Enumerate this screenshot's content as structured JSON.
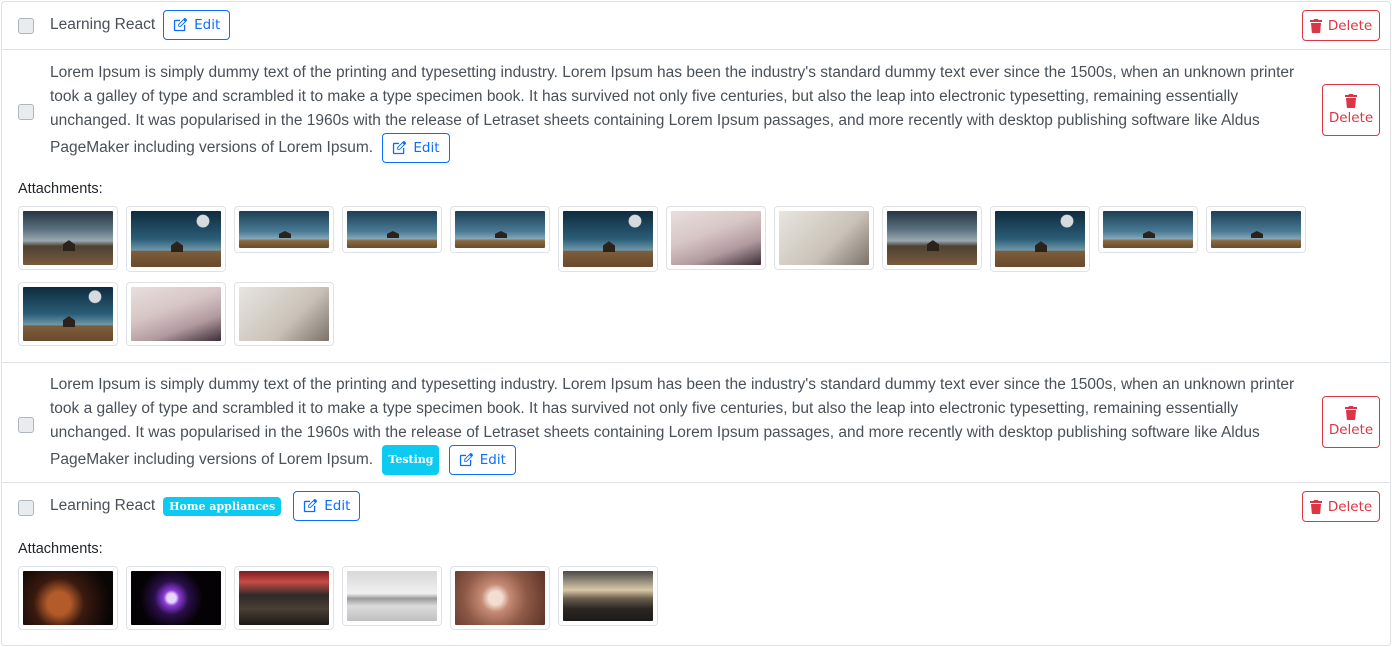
{
  "items": [
    {
      "title": "Learning React",
      "edit_label": "Edit",
      "delete_label": "Delete"
    },
    {
      "description": "Lorem Ipsum is simply dummy text of the printing and typesetting industry. Lorem Ipsum has been the industry's standard dummy text ever since the 1500s, when an unknown printer took a galley of type and scrambled it to make a type specimen book. It has survived not only five centuries, but also the leap into electronic typesetting, remaining essentially unchanged. It was popularised in the 1960s with the release of Letraset sheets containing Lorem Ipsum passages, and more recently with desktop publishing software like Aldus PageMaker including versions of Lorem Ipsum.",
      "edit_label": "Edit",
      "delete_label": "Delete",
      "attachments_label": "Attachments:"
    },
    {
      "description": "Lorem Ipsum is simply dummy text of the printing and typesetting industry. Lorem Ipsum has been the industry's standard dummy text ever since the 1500s, when an unknown printer took a galley of type and scrambled it to make a type specimen book. It has survived not only five centuries, but also the leap into electronic typesetting, remaining essentially unchanged. It was popularised in the 1960s with the release of Letraset sheets containing Lorem Ipsum passages, and more recently with desktop publishing software like Aldus PageMaker including versions of Lorem Ipsum.",
      "tag": "Testing",
      "edit_label": "Edit",
      "delete_label": "Delete"
    },
    {
      "title": "Learning React",
      "tag": "Home appliances",
      "edit_label": "Edit",
      "delete_label": "Delete",
      "attachments_label": "Attachments:"
    }
  ],
  "icons": {
    "edit": "pencil-square-icon",
    "delete": "trash-icon"
  },
  "colors": {
    "primary": "#0d6efd",
    "danger": "#dc3545",
    "info": "#0dcaf0"
  }
}
